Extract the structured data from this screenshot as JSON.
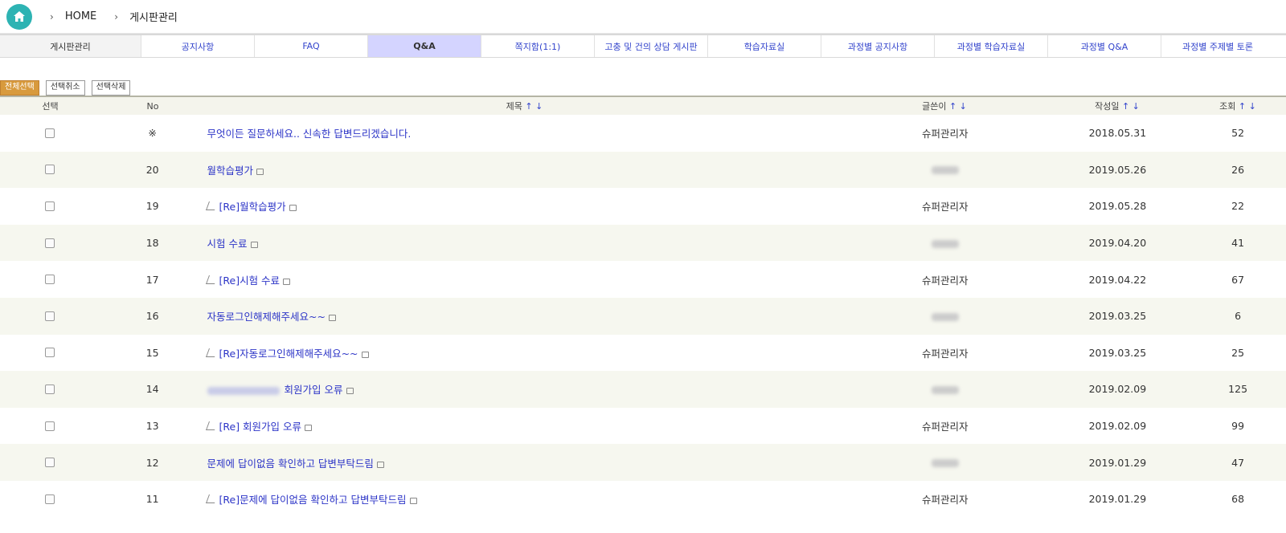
{
  "breadcrumb": {
    "sep": "›",
    "home": "HOME",
    "current": "게시판관리"
  },
  "tabs": [
    "게시판관리",
    "공지사항",
    "FAQ",
    "Q&A",
    "쪽지함(1:1)",
    "고충 및 건의 상담 게시판",
    "학습자료실",
    "과정별 공지사항",
    "과정별 학습자료실",
    "과정별 Q&A",
    "과정별 주제별 토론"
  ],
  "actions": {
    "select_all": "전체선택",
    "deselect": "선택취소",
    "delete": "선택삭제"
  },
  "header": {
    "select": "선택",
    "no": "No",
    "title": "제목",
    "writer": "글쓴이",
    "date": "작성일",
    "views": "조회",
    "sort": "↑ ↓"
  },
  "rows": [
    {
      "no": "※",
      "title": "무엇이든 질문하세요.. 신속한 답변드리겠습니다.",
      "writer": "슈퍼관리자",
      "date": "2018.05.31",
      "views": "52"
    },
    {
      "no": "20",
      "title": "월학습평가",
      "writer": "",
      "date": "2019.05.26",
      "views": "26"
    },
    {
      "no": "19",
      "title": "[Re]월학습평가",
      "writer": "슈퍼관리자",
      "date": "2019.05.28",
      "views": "22"
    },
    {
      "no": "18",
      "title": "시험 수료",
      "writer": "",
      "date": "2019.04.20",
      "views": "41"
    },
    {
      "no": "17",
      "title": "[Re]시험 수료",
      "writer": "슈퍼관리자",
      "date": "2019.04.22",
      "views": "67"
    },
    {
      "no": "16",
      "title": "자동로그인해제해주세요~~",
      "writer": "",
      "date": "2019.03.25",
      "views": "6"
    },
    {
      "no": "15",
      "title": "[Re]자동로그인해제해주세요~~",
      "writer": "슈퍼관리자",
      "date": "2019.03.25",
      "views": "25"
    },
    {
      "no": "14",
      "title": "회원가입 오류",
      "writer": "",
      "date": "2019.02.09",
      "views": "125"
    },
    {
      "no": "13",
      "title": "[Re] 회원가입 오류",
      "writer": "슈퍼관리자",
      "date": "2019.02.09",
      "views": "99"
    },
    {
      "no": "12",
      "title": "문제에 답이없음 확인하고 답변부탁드림",
      "writer": "",
      "date": "2019.01.29",
      "views": "47"
    },
    {
      "no": "11",
      "title": "[Re]문제에 답이없음 확인하고 답변부탁드림",
      "writer": "슈퍼관리자",
      "date": "2019.01.29",
      "views": "68"
    }
  ]
}
